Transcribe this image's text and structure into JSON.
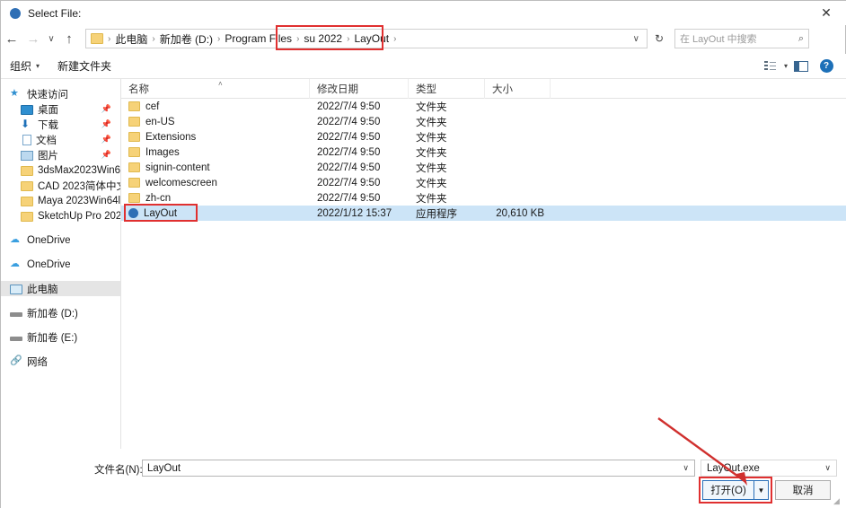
{
  "window": {
    "title": "Select File:",
    "title_icon": "app-circle-icon",
    "close_label": "✕"
  },
  "nav": {
    "back_icon": "←",
    "forward_icon": "→",
    "recent_icon": "∨",
    "up_icon": "↑",
    "refresh_icon": "↻",
    "dropdown_icon": "∨",
    "breadcrumb": [
      {
        "label": "此电脑"
      },
      {
        "label": "新加卷 (D:)"
      },
      {
        "label": "Program Files"
      },
      {
        "label": "su 2022"
      },
      {
        "label": "LayOut"
      }
    ],
    "separator": "›"
  },
  "search": {
    "placeholder": "在 LayOut 中搜索",
    "icon": "⌕"
  },
  "toolbar": {
    "organize_label": "组织",
    "new_folder_label": "新建文件夹",
    "caret": "▾",
    "view_caret": "▾",
    "help_label": "?"
  },
  "sidebar": {
    "items": [
      {
        "label": "快速访问",
        "icon": "star-icon",
        "indent": false,
        "pinned": false,
        "selected": false
      },
      {
        "label": "桌面",
        "icon": "desktop-icon",
        "indent": true,
        "pinned": true,
        "selected": false
      },
      {
        "label": "下载",
        "icon": "download-icon",
        "indent": true,
        "pinned": true,
        "selected": false
      },
      {
        "label": "文档",
        "icon": "document-icon",
        "indent": true,
        "pinned": true,
        "selected": false
      },
      {
        "label": "图片",
        "icon": "pictures-icon",
        "indent": true,
        "pinned": true,
        "selected": false
      },
      {
        "label": "3dsMax2023Win6",
        "icon": "folder-icon",
        "indent": true,
        "pinned": false,
        "selected": false
      },
      {
        "label": "CAD 2023简体中文",
        "icon": "folder-icon",
        "indent": true,
        "pinned": false,
        "selected": false
      },
      {
        "label": "Maya 2023Win64l",
        "icon": "folder-icon",
        "indent": true,
        "pinned": false,
        "selected": false
      },
      {
        "label": "SketchUp Pro 202",
        "icon": "folder-icon",
        "indent": true,
        "pinned": false,
        "selected": false
      },
      {
        "label": "OneDrive",
        "icon": "cloud-icon",
        "indent": false,
        "pinned": false,
        "selected": false
      },
      {
        "label": "OneDrive",
        "icon": "cloud-icon",
        "indent": false,
        "pinned": false,
        "selected": false
      },
      {
        "label": "此电脑",
        "icon": "this-pc-icon",
        "indent": false,
        "pinned": false,
        "selected": true
      },
      {
        "label": "新加卷 (D:)",
        "icon": "drive-icon",
        "indent": false,
        "pinned": false,
        "selected": false
      },
      {
        "label": "新加卷 (E:)",
        "icon": "drive-icon",
        "indent": false,
        "pinned": false,
        "selected": false
      },
      {
        "label": "网络",
        "icon": "network-icon",
        "indent": false,
        "pinned": false,
        "selected": false
      }
    ]
  },
  "filelist": {
    "columns": {
      "name": "名称",
      "date": "修改日期",
      "type": "类型",
      "size": "大小"
    },
    "sort_caret": "˄",
    "rows": [
      {
        "name": "cef",
        "date": "2022/7/4 9:50",
        "type": "文件夹",
        "size": "",
        "icon": "folder-icon",
        "selected": false
      },
      {
        "name": "en-US",
        "date": "2022/7/4 9:50",
        "type": "文件夹",
        "size": "",
        "icon": "folder-icon",
        "selected": false
      },
      {
        "name": "Extensions",
        "date": "2022/7/4 9:50",
        "type": "文件夹",
        "size": "",
        "icon": "folder-icon",
        "selected": false
      },
      {
        "name": "Images",
        "date": "2022/7/4 9:50",
        "type": "文件夹",
        "size": "",
        "icon": "folder-icon",
        "selected": false
      },
      {
        "name": "signin-content",
        "date": "2022/7/4 9:50",
        "type": "文件夹",
        "size": "",
        "icon": "folder-icon",
        "selected": false
      },
      {
        "name": "welcomescreen",
        "date": "2022/7/4 9:50",
        "type": "文件夹",
        "size": "",
        "icon": "folder-icon",
        "selected": false
      },
      {
        "name": "zh-cn",
        "date": "2022/7/4 9:50",
        "type": "文件夹",
        "size": "",
        "icon": "folder-icon",
        "selected": false
      },
      {
        "name": "LayOut",
        "date": "2022/1/12 15:37",
        "type": "应用程序",
        "size": "20,610 KB",
        "icon": "app-circle-icon",
        "selected": true
      }
    ]
  },
  "footer": {
    "filename_label": "文件名(N):",
    "filename_value": "LayOut",
    "filter_value": "LayOut.exe",
    "open_label": "打开(O)",
    "open_arrow": "▼",
    "cancel_label": "取消",
    "combo_caret": "∨"
  },
  "annotations": {
    "accent_color": "#e03030",
    "breadcrumb_box": "su 2022 › LayOut ›",
    "row_box": "LayOut",
    "open_box": "打开(O)"
  }
}
